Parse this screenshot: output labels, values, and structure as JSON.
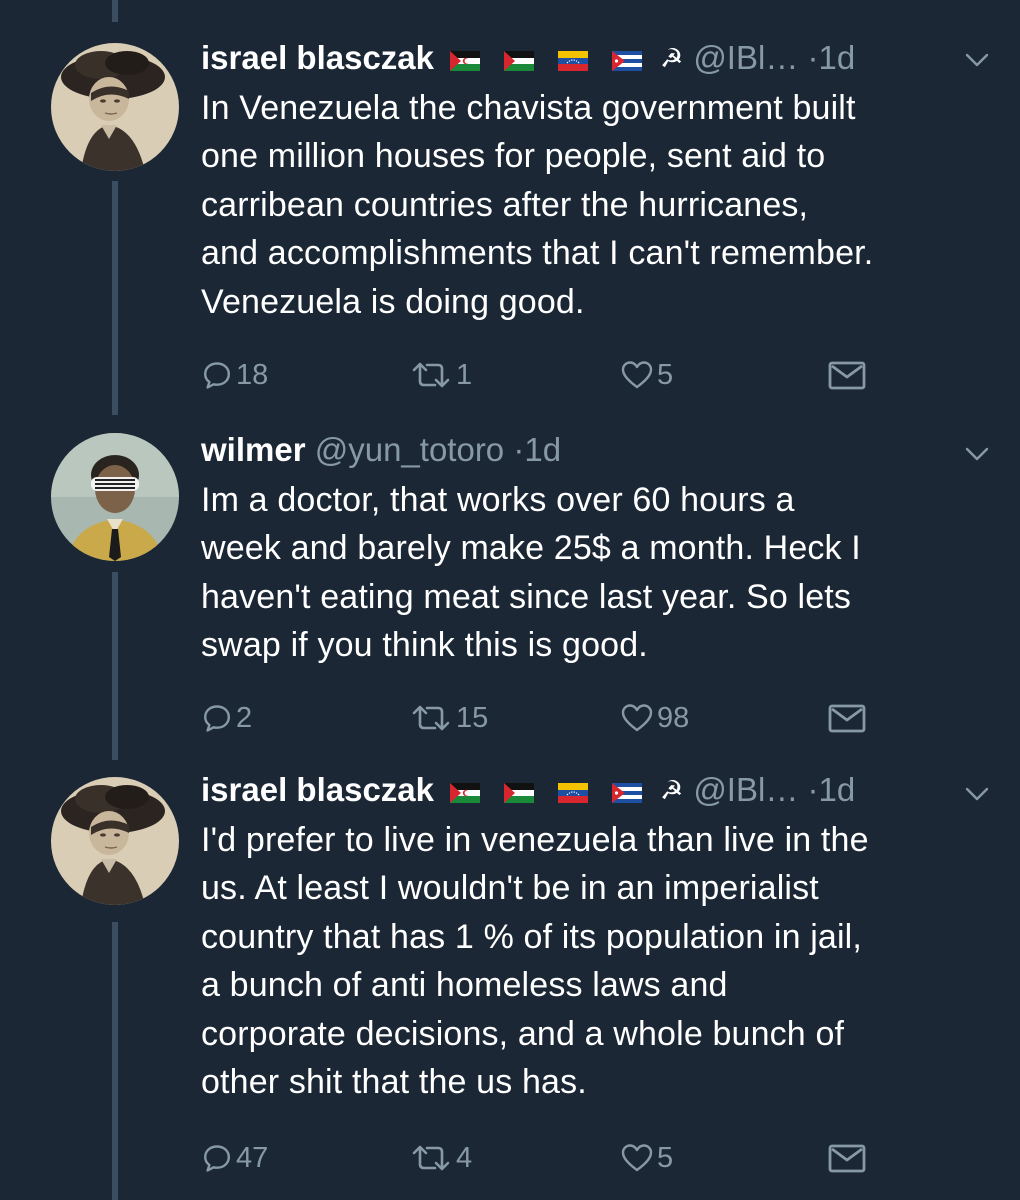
{
  "colors": {
    "background": "#1b2735",
    "text": "#ffffff",
    "secondary": "#8899a6",
    "thread_line": "#3b4d61"
  },
  "tweets": [
    {
      "name": "israel blasczak",
      "flags": [
        "sahrawi-flag",
        "palestine-flag",
        "venezuela-flag",
        "cuba-flag"
      ],
      "emoji": "☭",
      "handle": "@IBl…",
      "separator": "·",
      "time": "1d",
      "text": "In Venezuela the chavista government built\none million houses for people, sent aid to\ncarribean countries after the hurricanes,\nand accomplishments that I can't remember.\nVenezuela is doing good.",
      "replies": "18",
      "retweets": "1",
      "likes": "5"
    },
    {
      "name": "wilmer",
      "handle": "@yun_totoro",
      "separator": "·",
      "time": "1d",
      "text": "Im a doctor, that works over 60 hours a\nweek and barely make 25$ a month. Heck I\nhaven't eating meat since last year. So lets\nswap if you think this is good.",
      "replies": "2",
      "retweets": "15",
      "likes": "98"
    },
    {
      "name": "israel blasczak",
      "flags": [
        "sahrawi-flag",
        "palestine-flag",
        "venezuela-flag",
        "cuba-flag"
      ],
      "emoji": "☭",
      "handle": "@IBl…",
      "separator": "·",
      "time": "1d",
      "text": "I'd prefer to live in venezuela than live in the\nus. At least I wouldn't be in an imperialist\ncountry that has 1 % of its population in jail,\na bunch of anti homeless laws and\ncorporate decisions, and a whole bunch of\nother shit that the us has.",
      "replies": "47",
      "retweets": "4",
      "likes": "5"
    }
  ]
}
